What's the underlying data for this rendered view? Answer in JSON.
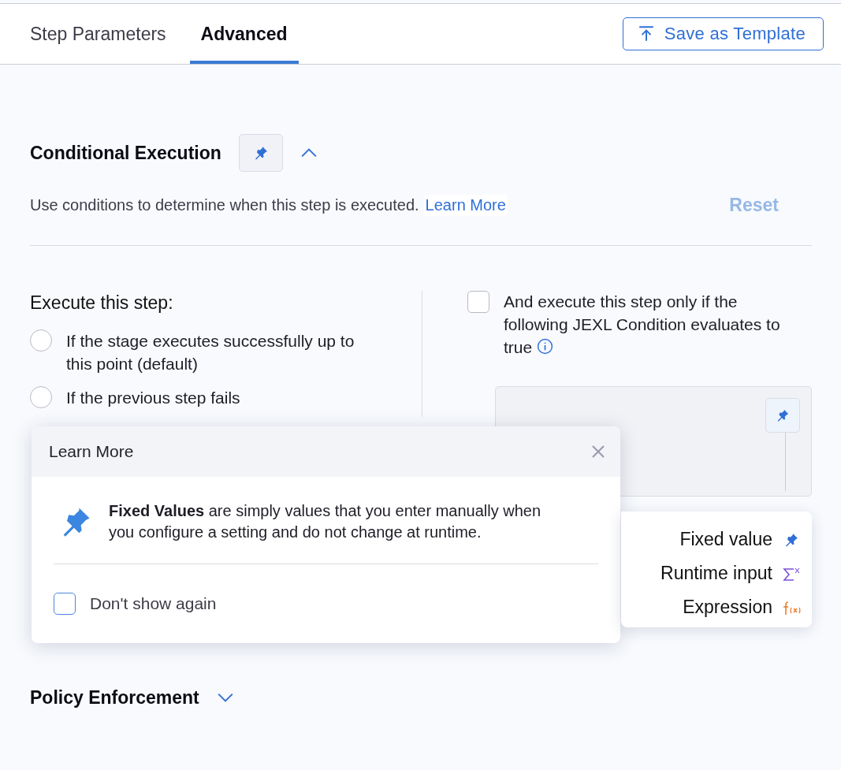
{
  "tabs": [
    {
      "label": "Step Parameters",
      "selected": false
    },
    {
      "label": "Advanced",
      "selected": true
    }
  ],
  "save_button": "Save as Template",
  "conditional_execution": {
    "title": "Conditional Execution",
    "expanded": true,
    "description": "Use conditions to determine when this step is executed.",
    "learn_more": "Learn More",
    "reset": "Reset",
    "reset_disabled": true,
    "execute_heading": "Execute this step:",
    "options": [
      {
        "label": "If the stage executes successfully up to this point (default)",
        "selected": false
      },
      {
        "label": "If the previous step fails",
        "selected": false
      }
    ],
    "condition": {
      "label": "And execute this step only if the following JEXL Condition evaluates to true",
      "checked": false
    }
  },
  "sections": [
    {
      "title": "Policy Enforcement",
      "expanded": false
    }
  ],
  "popover": {
    "title": "Learn More",
    "body": "**Fixed Values** are simply values that you enter manually when you configure a setting and do not change at runtime.",
    "dont_show": {
      "label": "Don't show again",
      "checked": false
    }
  },
  "menu": [
    {
      "label": "Fixed value",
      "kind": "fixed"
    },
    {
      "label": "Runtime input",
      "kind": "runtime"
    },
    {
      "label": "Expression",
      "kind": "expression"
    }
  ]
}
